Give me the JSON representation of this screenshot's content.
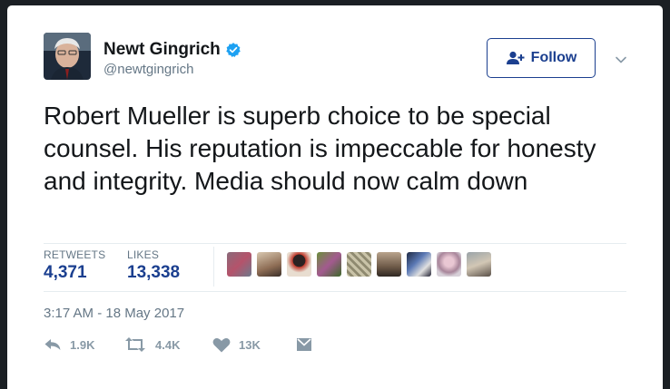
{
  "user": {
    "name": "Newt Gingrich",
    "handle": "@newtgingrich"
  },
  "follow_label": "Follow",
  "tweet_text": "Robert Mueller is superb choice to be special counsel. His reputation is impeccable for honesty and integrity. Media should now calm down",
  "stats": {
    "retweets_label": "RETWEETS",
    "retweets_value": "4,371",
    "likes_label": "LIKES",
    "likes_value": "13,338"
  },
  "timestamp": "3:17 AM - 18 May 2017",
  "actions": {
    "reply_count": "1.9K",
    "retweet_count": "4.4K",
    "like_count": "13K"
  },
  "colors": {
    "accent": "#1b3f8f",
    "muted": "#657786",
    "verified": "#1da1f2",
    "action_icon": "#8899a6"
  },
  "icons": [
    "verified-icon",
    "follow-person-icon",
    "chevron-down-icon",
    "reply-icon",
    "retweet-icon",
    "like-icon",
    "direct-message-icon"
  ]
}
